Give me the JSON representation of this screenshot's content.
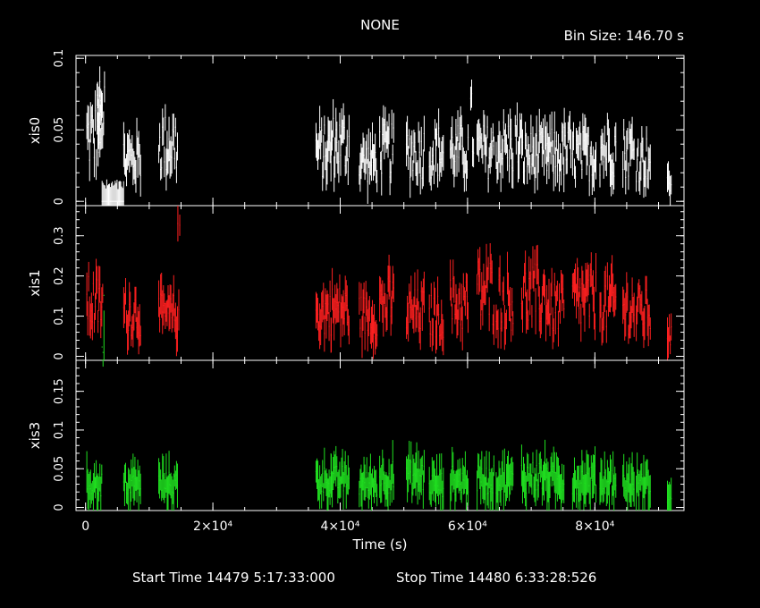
{
  "header": {
    "title": "NONE",
    "bin_size": "Bin Size: 146.70 s"
  },
  "footer": {
    "start_time": "Start Time 14479  5:17:33:000",
    "stop_time": "Stop Time 14480  6:33:28:526"
  },
  "chart_data": {
    "type": "scatter",
    "title": "NONE",
    "xlabel": "Time (s)",
    "xlim": [
      -1500,
      94000
    ],
    "x_ticks": [
      0,
      20000,
      40000,
      60000,
      80000
    ],
    "x_tick_labels": [
      "0",
      "2×10⁴",
      "4×10⁴",
      "6×10⁴",
      "8×10⁴"
    ],
    "panels": [
      {
        "name": "xis0",
        "ylabel": "xis0",
        "ylim": [
          -0.003,
          0.102
        ],
        "y_ticks": [
          0,
          0.05,
          0.1
        ],
        "y_tick_labels": [
          "0",
          "0.05",
          "0.1"
        ],
        "color": "#ffffff",
        "segments": [
          {
            "start": 200,
            "end": 2400,
            "level": 0.045
          },
          {
            "start": 1800,
            "end": 2600,
            "level": 0.055
          },
          {
            "start": 1900,
            "end": 2700,
            "level": 0.055
          },
          {
            "start": 1950,
            "end": 3000,
            "level": 0.06
          },
          {
            "start": 2600,
            "end": 6000,
            "level": 0.0
          },
          {
            "start": 6000,
            "end": 8700,
            "level": 0.03
          },
          {
            "start": 11500,
            "end": 14500,
            "level": 0.04
          },
          {
            "start": 36200,
            "end": 38600,
            "level": 0.035
          },
          {
            "start": 38600,
            "end": 41500,
            "level": 0.04
          },
          {
            "start": 43000,
            "end": 45800,
            "level": 0.028
          },
          {
            "start": 46200,
            "end": 48500,
            "level": 0.035
          },
          {
            "start": 50400,
            "end": 53300,
            "level": 0.035
          },
          {
            "start": 54000,
            "end": 56300,
            "level": 0.035
          },
          {
            "start": 57300,
            "end": 60200,
            "level": 0.035
          },
          {
            "start": 60500,
            "end": 61000,
            "level": 0.05
          },
          {
            "start": 61500,
            "end": 64200,
            "level": 0.035
          },
          {
            "start": 64500,
            "end": 67200,
            "level": 0.038
          },
          {
            "start": 67500,
            "end": 68400,
            "level": 0.04
          },
          {
            "start": 68500,
            "end": 72500,
            "level": 0.032
          },
          {
            "start": 72500,
            "end": 75200,
            "level": 0.033
          },
          {
            "start": 75200,
            "end": 76300,
            "level": 0.035
          },
          {
            "start": 76500,
            "end": 80200,
            "level": 0.032
          },
          {
            "start": 80800,
            "end": 83300,
            "level": 0.038
          },
          {
            "start": 84400,
            "end": 86200,
            "level": 0.035
          },
          {
            "start": 86500,
            "end": 88800,
            "level": 0.03
          },
          {
            "start": 91400,
            "end": 92000,
            "level": 0.012
          }
        ]
      },
      {
        "name": "xis1",
        "ylabel": "xis1",
        "ylim": [
          -0.01,
          0.375
        ],
        "y_ticks": [
          0,
          0.1,
          0.2,
          0.3
        ],
        "y_tick_labels": [
          "0",
          "0.1",
          "0.2",
          "0.3"
        ],
        "color": "#ff2020",
        "segments": [
          {
            "start": 200,
            "end": 2800,
            "level": 0.13
          },
          {
            "start": 6000,
            "end": 8700,
            "level": 0.11
          },
          {
            "start": 11500,
            "end": 14500,
            "level": 0.1
          },
          {
            "start": 14500,
            "end": 14800,
            "level": 0.22
          },
          {
            "start": 36200,
            "end": 38600,
            "level": 0.11
          },
          {
            "start": 38600,
            "end": 41500,
            "level": 0.115
          },
          {
            "start": 43000,
            "end": 45800,
            "level": 0.1
          },
          {
            "start": 46200,
            "end": 48500,
            "level": 0.13
          },
          {
            "start": 50400,
            "end": 53300,
            "level": 0.11
          },
          {
            "start": 54000,
            "end": 56300,
            "level": 0.1
          },
          {
            "start": 57300,
            "end": 60200,
            "level": 0.13
          },
          {
            "start": 61500,
            "end": 64200,
            "level": 0.16
          },
          {
            "start": 64500,
            "end": 67200,
            "level": 0.14
          },
          {
            "start": 68500,
            "end": 72500,
            "level": 0.15
          },
          {
            "start": 72500,
            "end": 75200,
            "level": 0.12
          },
          {
            "start": 76500,
            "end": 80200,
            "level": 0.14
          },
          {
            "start": 80800,
            "end": 83300,
            "level": 0.13
          },
          {
            "start": 84400,
            "end": 86200,
            "level": 0.12
          },
          {
            "start": 86500,
            "end": 88800,
            "level": 0.11
          },
          {
            "start": 91400,
            "end": 92000,
            "level": 0.05
          }
        ]
      },
      {
        "name": "xis3",
        "ylabel": "xis3",
        "ylim": [
          -0.004,
          0.19
        ],
        "y_ticks": [
          0,
          0.05,
          0.1,
          0.15
        ],
        "y_tick_labels": [
          "0",
          "0.05",
          "0.1",
          "0.15"
        ],
        "color": "#20e020",
        "segments": [
          {
            "start": 200,
            "end": 2600,
            "level": 0.03
          },
          {
            "start": 2600,
            "end": 3000,
            "level": 0.19
          },
          {
            "start": 6000,
            "end": 8700,
            "level": 0.03
          },
          {
            "start": 11500,
            "end": 14500,
            "level": 0.03
          },
          {
            "start": 36200,
            "end": 38600,
            "level": 0.035
          },
          {
            "start": 38600,
            "end": 41500,
            "level": 0.035
          },
          {
            "start": 43000,
            "end": 45800,
            "level": 0.03
          },
          {
            "start": 46200,
            "end": 48500,
            "level": 0.04
          },
          {
            "start": 50400,
            "end": 53300,
            "level": 0.04
          },
          {
            "start": 54000,
            "end": 56300,
            "level": 0.03
          },
          {
            "start": 57300,
            "end": 60200,
            "level": 0.035
          },
          {
            "start": 61500,
            "end": 64200,
            "level": 0.035
          },
          {
            "start": 64500,
            "end": 67200,
            "level": 0.035
          },
          {
            "start": 68500,
            "end": 72500,
            "level": 0.04
          },
          {
            "start": 72500,
            "end": 75200,
            "level": 0.035
          },
          {
            "start": 76500,
            "end": 80200,
            "level": 0.035
          },
          {
            "start": 80800,
            "end": 83300,
            "level": 0.035
          },
          {
            "start": 84400,
            "end": 86200,
            "level": 0.03
          },
          {
            "start": 86500,
            "end": 88800,
            "level": 0.03
          },
          {
            "start": 91400,
            "end": 92000,
            "level": 0.01
          }
        ]
      }
    ]
  }
}
